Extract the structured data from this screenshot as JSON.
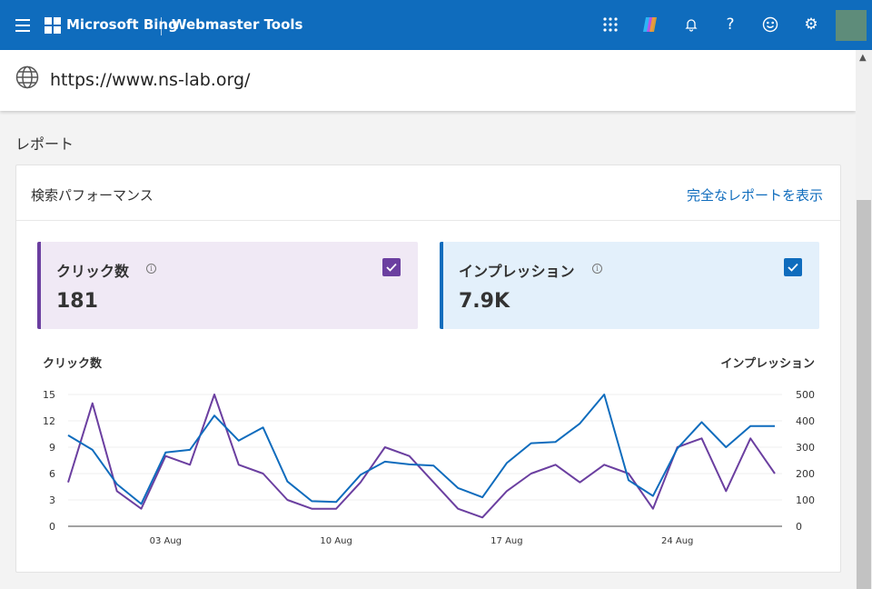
{
  "header": {
    "brand": "Microsoft Bing",
    "product": "Webmaster Tools",
    "icons": [
      "apps-grid-icon",
      "copilot-icon",
      "bell-icon",
      "help-icon",
      "smiley-feedback-icon",
      "gear-icon"
    ],
    "accent_color": "#0f6cbd"
  },
  "site": {
    "url": "https://www.ns-lab.org/"
  },
  "section": {
    "title": "レポート"
  },
  "card": {
    "title": "検索パフォーマンス",
    "link": "完全なレポートを表示",
    "metrics": [
      {
        "label": "クリック数",
        "value": "181",
        "checked": true,
        "color": "#6b3fa0"
      },
      {
        "label": "インプレッション",
        "value": "7.9K",
        "checked": true,
        "color": "#0f6cbd"
      }
    ]
  },
  "chart_data": {
    "type": "line",
    "y_left_label": "クリック数",
    "y_right_label": "インプレッション",
    "y_left_ticks": [
      "15",
      "12",
      "9",
      "6",
      "3",
      "0"
    ],
    "y_right_ticks": [
      "500",
      "400",
      "300",
      "200",
      "100",
      "0"
    ],
    "ylim_left": [
      0,
      15
    ],
    "ylim_right": [
      0,
      500
    ],
    "x_tick_labels": [
      "03 Aug",
      "10 Aug",
      "17 Aug",
      "24 Aug"
    ],
    "x_tick_index": [
      4,
      11,
      18,
      25
    ],
    "grid": true,
    "series": [
      {
        "name": "クリック数",
        "axis": "left",
        "color": "#6b3fa0",
        "values": [
          5,
          14,
          4,
          2,
          8,
          7,
          15,
          7,
          6,
          3,
          2,
          2,
          5,
          9,
          8,
          5,
          2,
          1,
          4,
          6,
          7,
          5,
          7,
          6,
          2,
          9,
          10,
          4,
          10,
          6
        ]
      },
      {
        "name": "インプレッション",
        "axis": "right",
        "color": "#0f6cbd",
        "values": [
          345,
          290,
          160,
          85,
          280,
          290,
          420,
          325,
          375,
          170,
          95,
          92,
          195,
          245,
          235,
          230,
          145,
          110,
          240,
          315,
          320,
          390,
          500,
          175,
          115,
          295,
          395,
          300,
          380,
          380
        ]
      }
    ]
  }
}
